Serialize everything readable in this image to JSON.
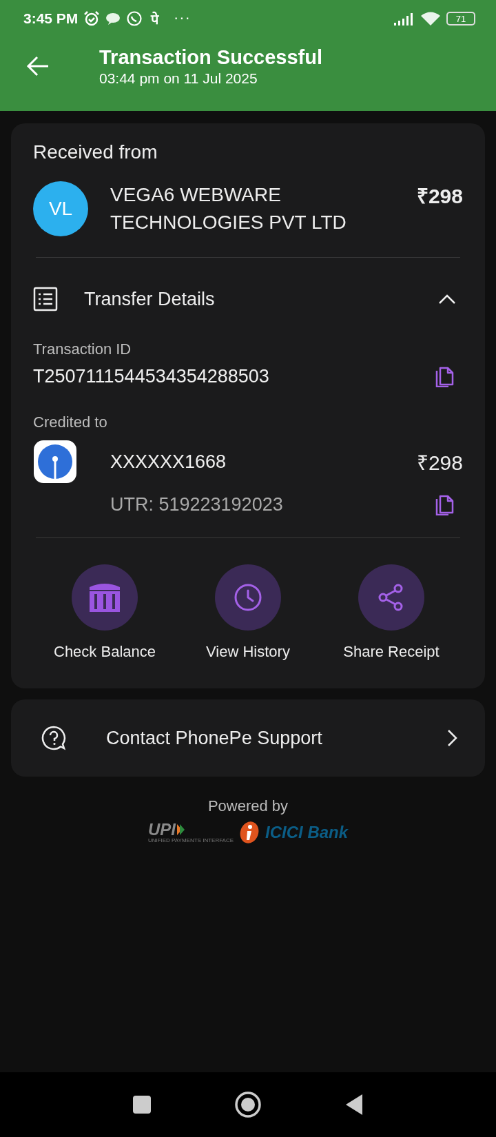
{
  "status_bar": {
    "time": "3:45 PM",
    "app_glyph": "पे",
    "more": "···",
    "battery": "71"
  },
  "header": {
    "title": "Transaction Successful",
    "subtitle": "03:44 pm on 11 Jul 2025"
  },
  "received": {
    "label": "Received from",
    "initials": "VL",
    "name": "VEGA6 WEBWARE TECHNOLOGIES PVT LTD",
    "amount": "₹298"
  },
  "transfer_details": {
    "title": "Transfer Details",
    "expanded": true,
    "transaction_id": {
      "label": "Transaction ID",
      "value": "T2507111544534354288503"
    },
    "credited_to": {
      "label": "Credited to",
      "account": "XXXXXX1668",
      "amount": "₹298",
      "utr": "UTR: 519223192023"
    }
  },
  "actions": [
    {
      "kind": "bank",
      "label": "Check Balance"
    },
    {
      "kind": "history",
      "label": "View History"
    },
    {
      "kind": "share",
      "label": "Share Receipt"
    }
  ],
  "support": {
    "label": "Contact PhonePe Support"
  },
  "footer": {
    "powered_by": "Powered by",
    "upi": "UPI",
    "upi_tagline": "UNIFIED PAYMENTS INTERFACE",
    "bank": "ICICI Bank"
  }
}
